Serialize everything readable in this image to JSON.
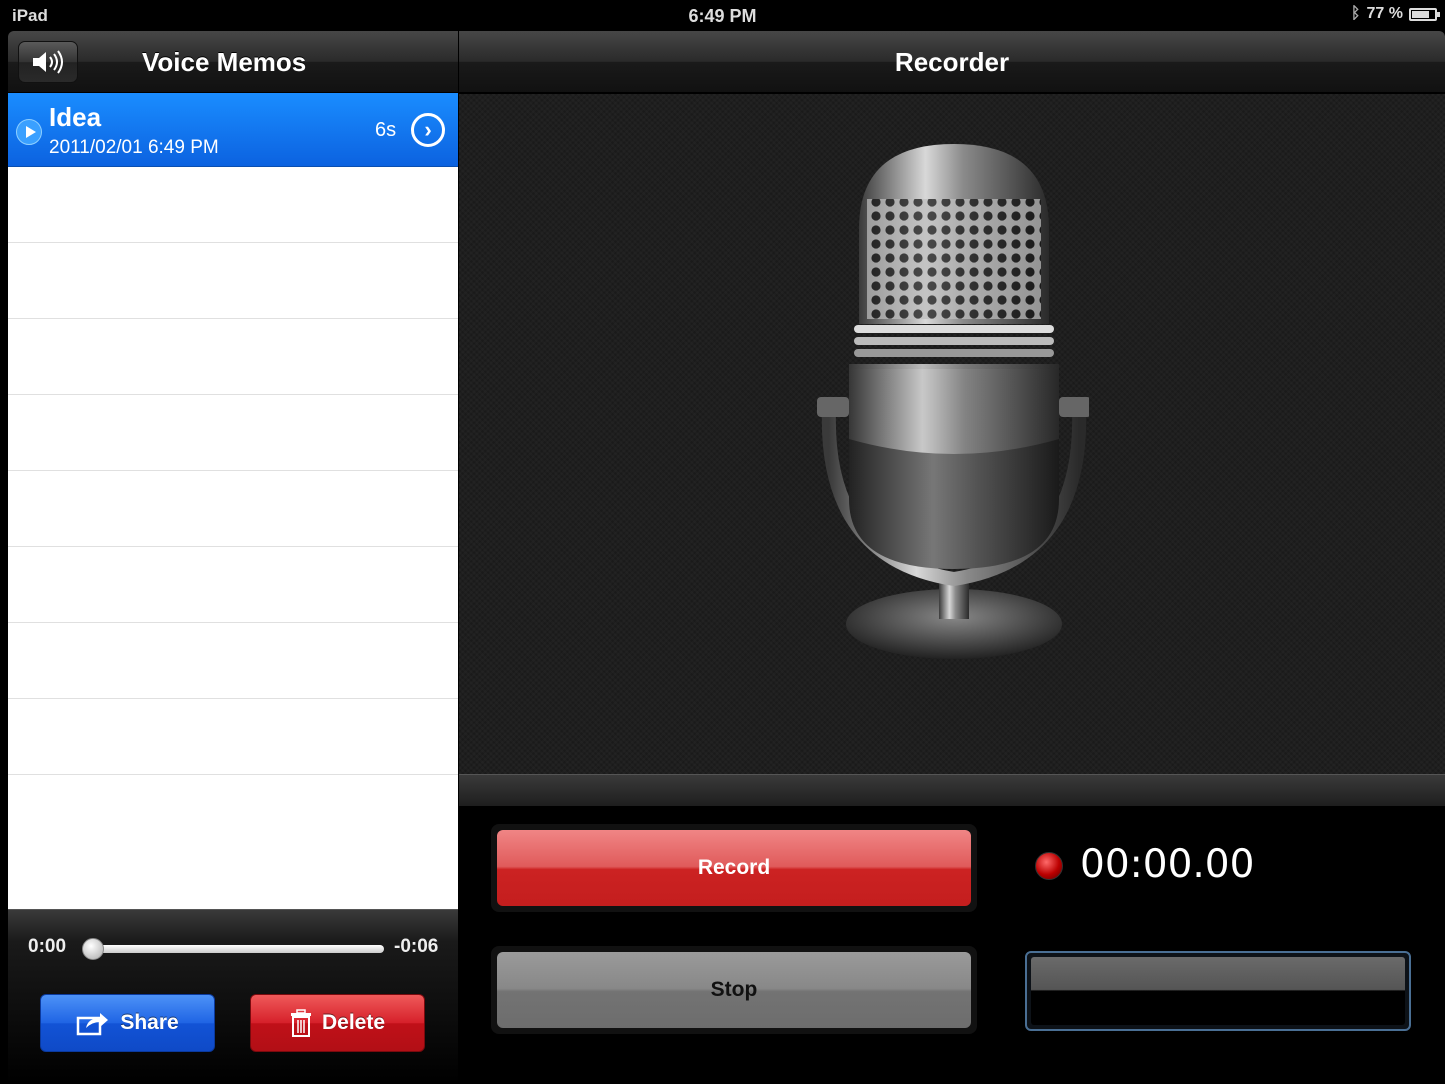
{
  "status_bar": {
    "device": "iPad",
    "time": "6:49 PM",
    "battery_text": "77 %",
    "battery_level": 0.77
  },
  "left_panel": {
    "title": "Voice Memos",
    "memos": [
      {
        "name": "Idea",
        "date": "2011/02/01 6:49 PM",
        "duration": "6s",
        "selected": true
      }
    ],
    "player": {
      "elapsed": "0:00",
      "remaining": "-0:06",
      "progress": 0.0
    },
    "share_label": "Share",
    "delete_label": "Delete"
  },
  "right_panel": {
    "title": "Recorder",
    "record_label": "Record",
    "stop_label": "Stop",
    "timer": "00:00.00"
  },
  "colors": {
    "selected_row": "#0c62e0",
    "share_button": "#1f64e4",
    "delete_button": "#c01018",
    "record_button": "#cc2222",
    "stop_button": "#888888",
    "meter_border": "#4a6f94"
  },
  "icons": [
    "speaker-icon",
    "play-icon",
    "disclosure-chevron-icon",
    "share-icon",
    "trash-icon",
    "bluetooth-icon",
    "battery-icon",
    "microphone-illustration",
    "record-led-icon"
  ]
}
